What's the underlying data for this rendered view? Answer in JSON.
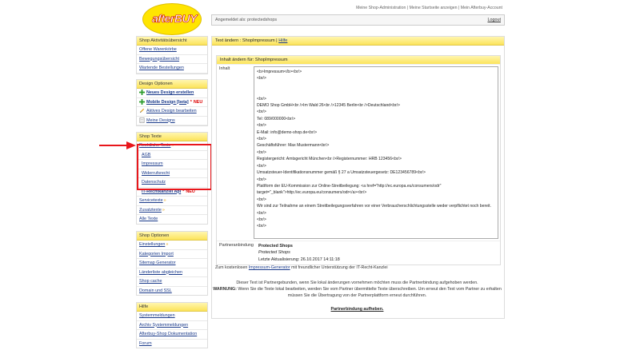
{
  "logo": {
    "text": "afterBUY"
  },
  "top_links": {
    "admin": "Meine Shop-Administration",
    "sep1": " | ",
    "startseite": "Meine Startseite anzeigen",
    "sep2": " | ",
    "account": "Mein Afterbuy-Account"
  },
  "login": {
    "label": "Angemeldet als: protectedshops",
    "logout": "Logout"
  },
  "sidebar": {
    "activity": {
      "title": "Shop Aktivitätsübersicht",
      "items": [
        "Offene Warenkörbe",
        "Bewegungsübersicht",
        "Wartende Bestellungen"
      ]
    },
    "design": {
      "title": "Design Optionen",
      "new_design": "Neues Design erstellen",
      "mobile_design": "Mobile Design [beta]",
      "mobile_star": "*",
      "neu": "NEU",
      "active_design": "Aktives Design bearbeiten",
      "my_designs": "Meine Designs"
    },
    "texts": {
      "title": "Shop Texte",
      "legal": "Rechtliche Texte",
      "legal_arrow": "»",
      "sub": [
        "AGB",
        "Impressum",
        "Widerrufsrecht",
        "Datenschutz"
      ],
      "it_recht": "IT-Rechtkanzlei Api",
      "it_star": "*",
      "neu": "NEU",
      "servicetexte": "Servicetexte",
      "zusatztexte": "Zusatztexte",
      "arrow": "»",
      "alle": "Alle Texte"
    },
    "shop_options": {
      "title": "Shop Optionen",
      "items": [
        "Einstellungen",
        "Kategorien Import",
        "Sitemap Generator",
        "Länderliste abgleichen",
        "Shop cache",
        "Domain und SSL"
      ],
      "arrow": "»"
    },
    "help": {
      "title": "Hilfe",
      "items": [
        "Systemmeldungen",
        "Archiv Systemmeldungen",
        "Afterbuy-Shop Dokumentation",
        "Forum"
      ]
    }
  },
  "main": {
    "header_prefix": "Text ändern : ShopImpressum | ",
    "header_help": "Hilfe",
    "inner_title": "Inhalt ändern für: ShopImpressum",
    "inhalt_label": "Inhalt",
    "textarea_lines": [
      "<b>Impressum</b><br/>",
      "<br/>",
      "",
      "",
      "<br/>",
      "DEMO Shop GmbH<br />Im Wald 26<br />12345 Berlin<br />Deutschland<br/>",
      "<br/>",
      "Tel: 089/000000<br/>",
      "<br/>",
      "E-Mail: info@demo-shop.de<br/>",
      "<br/>",
      "Geschäftsführer: Max Mustermann<br/>",
      "<br/>",
      "Registergericht: Amtsgericht München<br />Registernummer: HRB 123456<br/>",
      "<br/>",
      "Umsatzsteuer-Identifikationsnummer gemäß § 27 a Umsatzsteuergesetz: DE123456789<br/>",
      "<br/>",
      "Plattform der EU-Kommission zur Online-Streitbeilegung: <a href=\"http://ec.europa.eu/consumers/odr\"",
      "target=\"_blank\">http://ec.europa.eu/consumers/odr</a><br/>",
      "<br/>",
      "Wir sind zur Teilnahme an einem Streitbeilegungsverfahren vor einer Verbraucherschlichtungsstelle weder verpflichtet noch bereit.",
      "<br/>",
      "<br/>",
      "<br/>"
    ],
    "partner_label": "Partneranbindung",
    "partner_name": "Protected Shops",
    "partner_sub": "Protected Shops",
    "partner_updated": "Letzte Aktualisierung: 26.10.2017 14:11:18",
    "note_prefix": "Zum kostenlosen ",
    "note_link": "Impressum-Generator",
    "note_suffix": " mit freundlicher Unterstützung der IT-Recht-Kanzlei",
    "warn_line1": "Dieser Text ist Partnergebunden, wenn Sie lokal änderungen vornehmen möchten muss die Partnerbindung aufgehoben werden.",
    "warn_label": "WARNUNG:",
    "warn_line2": " Wenn Sie die Texte lokal bearbeiten, werden Sie vom Partner übermittelte Texte überschreiben. Um erneut den Text vom Partner zu erhalten",
    "warn_line3": "müssen Sie die Übertragung von der Partnerplattform erneut durchführen.",
    "unlink": "Partnerbindung aufheben."
  }
}
